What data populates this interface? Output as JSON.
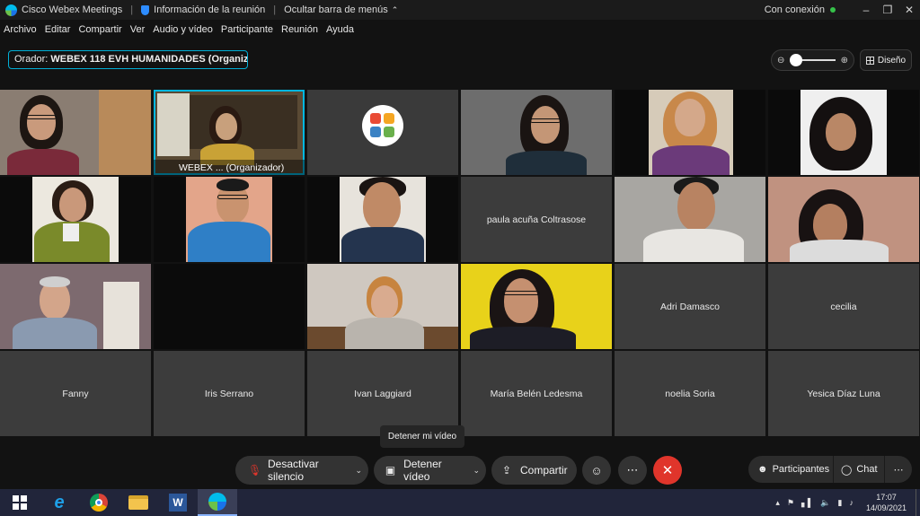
{
  "titlebar": {
    "app": "Cisco Webex Meetings",
    "meeting_info": "Información de la reunión",
    "hide_menu": "Ocultar barra de menús",
    "connection": "Con conexión",
    "status_color": "#36c24a"
  },
  "menu": [
    "Archivo",
    "Editar",
    "Compartir",
    "Ver",
    "Audio y vídeo",
    "Participante",
    "Reunión",
    "Ayuda"
  ],
  "speaker": {
    "label": "Orador:",
    "name": "WEBEX 118 EVH HUMANIDADES (Organizad..."
  },
  "layout_button": "Diseño",
  "grid": {
    "active_label": "WEBEX ... (Organizador)",
    "name_tiles": {
      "paula": "paula acuña Coltrasose",
      "adri": "Adri Damasco",
      "cecilia": "cecilia",
      "fanny": "Fanny",
      "iris": "Iris Serrano",
      "ivan": "Ivan Laggiard",
      "maria": "María Belén Ledesma",
      "noelia": "noelia Soria",
      "yesica": "Yesica Díaz Luna"
    }
  },
  "controls": {
    "tooltip": "Detener mi vídeo",
    "mute": "Desactivar silencio",
    "video": "Detener vídeo",
    "share": "Compartir",
    "participants": "Participantes",
    "chat": "Chat"
  },
  "taskbar": {
    "time": "17:07",
    "date": "14/09/2021"
  },
  "colors": {
    "accent": "#00b7e0",
    "end_call": "#e0352b"
  }
}
